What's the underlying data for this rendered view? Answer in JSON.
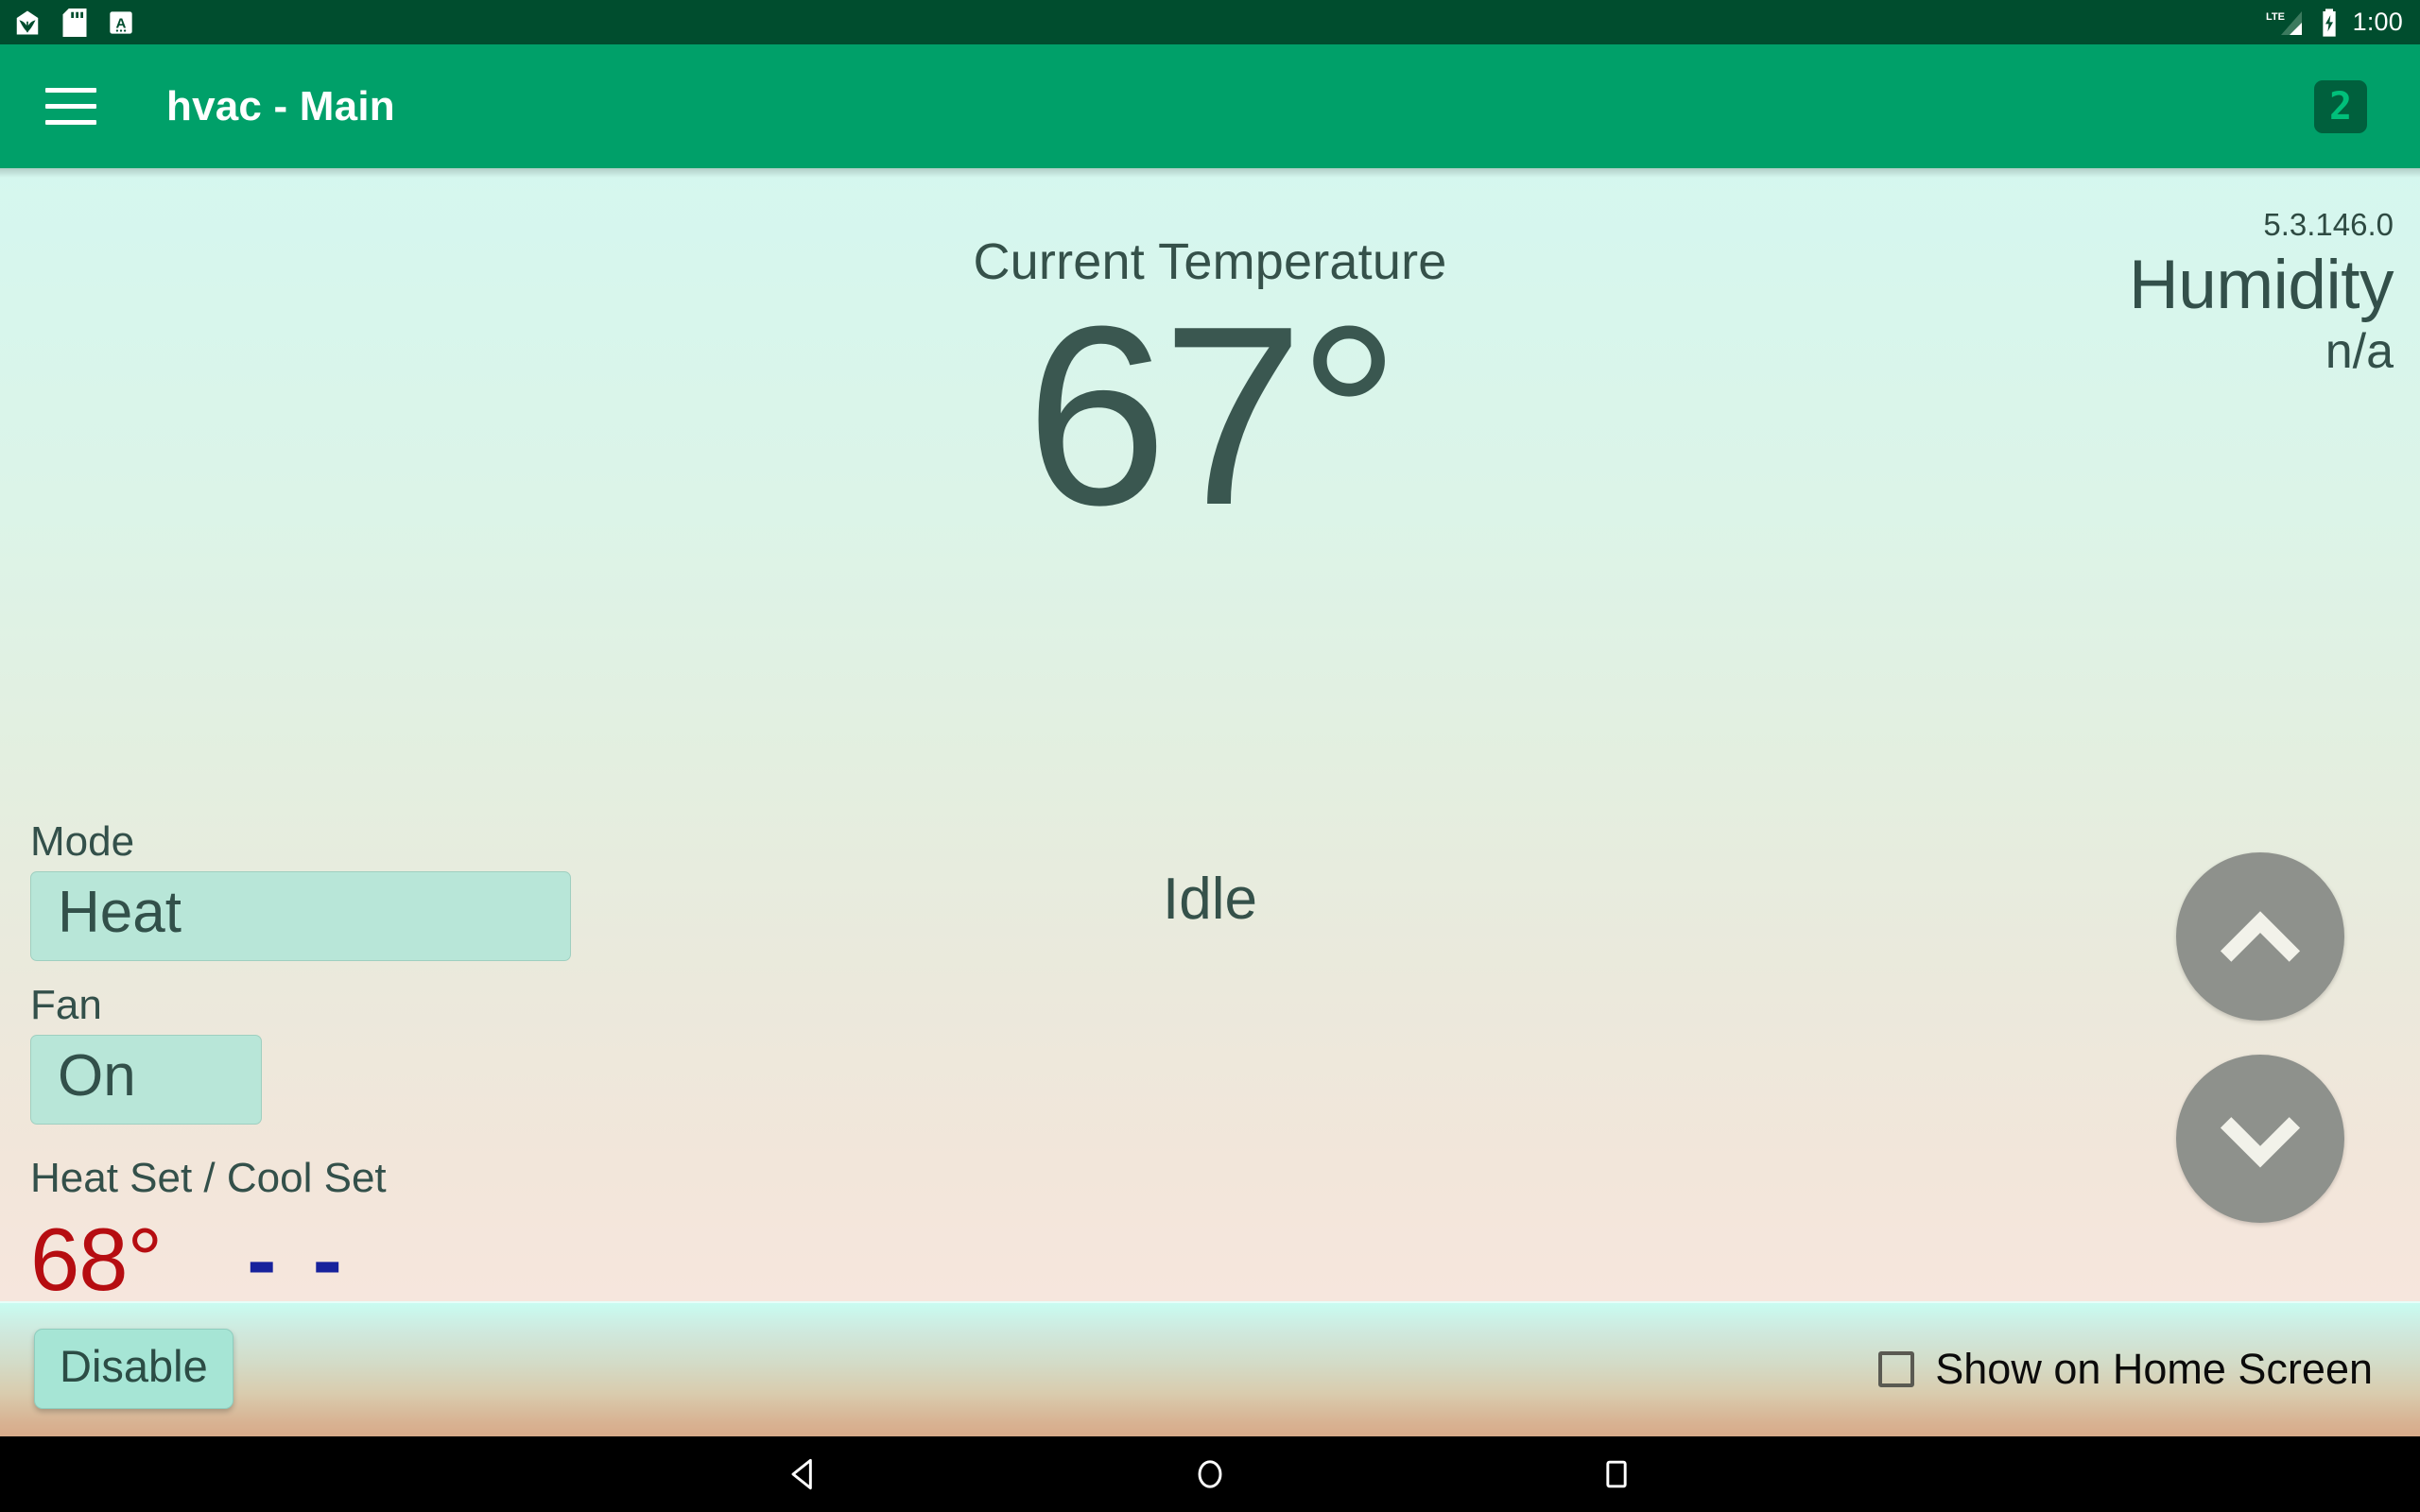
{
  "status_bar": {
    "icons": [
      "home-plant-notification-icon",
      "sd-card-icon",
      "font-size-a-icon"
    ],
    "network": "LTE",
    "battery": "charging",
    "clock": "1:00"
  },
  "app_bar": {
    "menu_icon": "hamburger-menu-icon",
    "title": "hvac - Main",
    "zone_badge": "2"
  },
  "main": {
    "version": "5.3.146.0",
    "humidity_label": "Humidity",
    "humidity_value": "n/a",
    "temperature_caption": "Current Temperature",
    "temperature_value": "67°",
    "hvac_state": "Idle",
    "mode_label": "Mode",
    "mode_value": "Heat",
    "fan_label": "Fan",
    "fan_value": "On",
    "setpoints_label": "Heat Set / Cool Set",
    "heat_set": "68°",
    "cool_set": "- -",
    "stepper_up_icon": "chevron-up-icon",
    "stepper_down_icon": "chevron-down-icon"
  },
  "bottom_bar": {
    "disable_label": "Disable",
    "show_on_home_label": "Show on Home Screen",
    "show_on_home_checked": false
  },
  "nav_bar": {
    "back": "back-triangle-icon",
    "home": "home-circle-icon",
    "recents": "recents-square-icon"
  },
  "colors": {
    "status_bar": "#004d2e",
    "app_bar": "#00a069",
    "badge_bg": "#00603d",
    "badge_text": "#00c07a",
    "heat_set": "#b60d11",
    "cool_set": "#17229c",
    "text_primary": "#33504a",
    "fab": "#8e918c",
    "button_fill": "#b8e6d8"
  }
}
